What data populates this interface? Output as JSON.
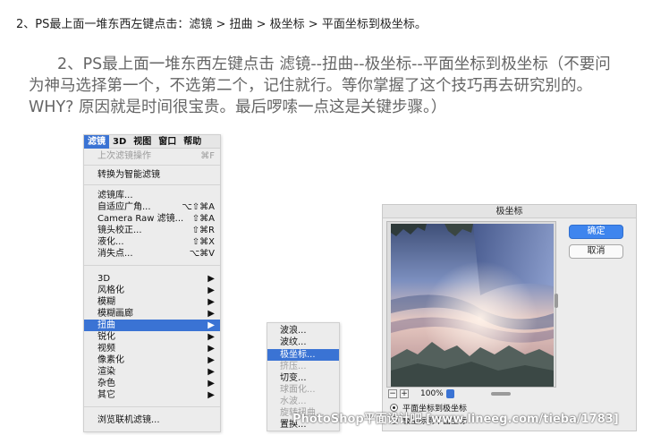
{
  "heading": "2、PS最上面一堆东西左键点击：滤镜 > 扭曲 > 极坐标 > 平面坐标到极坐标。",
  "paragraph": {
    "line1": "2、PS最上面一堆东西左键点击 滤镜--扭曲--极坐标--平面坐标到极坐标（不要问",
    "line2": "为神马选择第一个，不选第二个，记住就行。等你掌握了这个技巧再去研究别的。",
    "line3": "WHY? 原因就是时间很宝贵。最后啰嗦一点这是关键步骤。）"
  },
  "menubar": {
    "items": [
      "滤镜",
      "3D",
      "视图",
      "窗口",
      "帮助"
    ],
    "active": "滤镜"
  },
  "filter_menu": {
    "last_filter": {
      "label": "上次滤镜操作",
      "shortcut": "⌘F"
    },
    "convert_smart": "转换为智能滤镜",
    "group1": [
      {
        "label": "滤镜库...",
        "shortcut": ""
      },
      {
        "label": "自适应广角...",
        "shortcut": "⌥⇧⌘A"
      },
      {
        "label": "Camera Raw 滤镜...",
        "shortcut": "⇧⌘A"
      },
      {
        "label": "镜头校正...",
        "shortcut": "⇧⌘R"
      },
      {
        "label": "液化...",
        "shortcut": "⇧⌘X"
      },
      {
        "label": "消失点...",
        "shortcut": "⌥⌘V"
      }
    ],
    "group2": [
      {
        "label": "3D",
        "arrow": "▶"
      },
      {
        "label": "风格化",
        "arrow": "▶"
      },
      {
        "label": "模糊",
        "arrow": "▶"
      },
      {
        "label": "模糊画廊",
        "arrow": "▶"
      },
      {
        "label": "扭曲",
        "arrow": "▶"
      },
      {
        "label": "锐化",
        "arrow": "▶"
      },
      {
        "label": "视频",
        "arrow": "▶"
      },
      {
        "label": "像素化",
        "arrow": "▶"
      },
      {
        "label": "渲染",
        "arrow": "▶"
      },
      {
        "label": "杂色",
        "arrow": "▶"
      },
      {
        "label": "其它",
        "arrow": "▶"
      }
    ],
    "browse": "浏览联机滤镜..."
  },
  "distort_submenu": {
    "items": [
      {
        "label": "波浪...",
        "state": "normal"
      },
      {
        "label": "波纹...",
        "state": "normal"
      },
      {
        "label": "极坐标...",
        "state": "highlighted"
      },
      {
        "label": "挤压...",
        "state": "disabled"
      },
      {
        "label": "切变...",
        "state": "normal"
      },
      {
        "label": "球面化...",
        "state": "disabled"
      },
      {
        "label": "水波...",
        "state": "disabled"
      },
      {
        "label": "旋转扭曲...",
        "state": "disabled"
      },
      {
        "label": "置换...",
        "state": "normal"
      }
    ]
  },
  "dialog": {
    "title": "极坐标",
    "ok_label": "确定",
    "cancel_label": "取消",
    "zoom_out_label": "−",
    "zoom_in_label": "+",
    "zoom": "100%",
    "option_rect_to_polar": "平面坐标到极坐标",
    "option_polar_to_rect": "极坐标到平面坐标",
    "selected_option": "平面坐标到极坐标"
  },
  "watermark": "PhotoShop平面设计吧 [www.lineeg.com/tieba/1783]",
  "colors": {
    "highlight": "#3a73d4",
    "primary_button": "#3e85ee"
  }
}
